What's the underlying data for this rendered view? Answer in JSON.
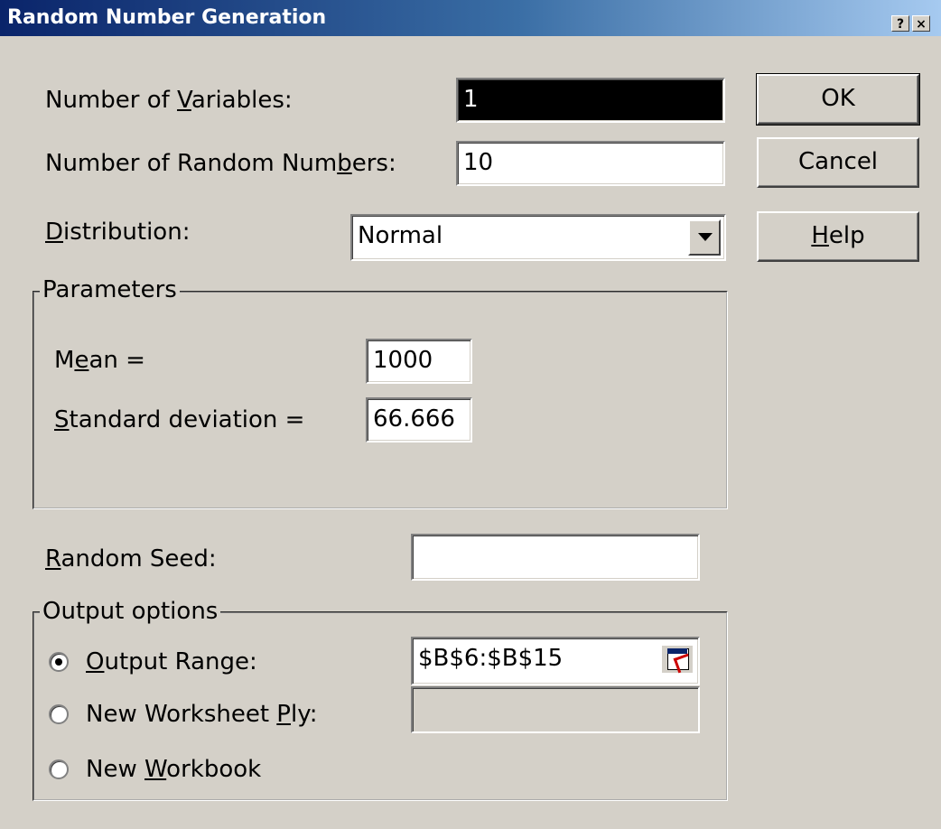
{
  "window": {
    "title": "Random Number Generation",
    "help_glyph": "?",
    "close_glyph": "×"
  },
  "fields": {
    "num_variables": {
      "label_pre": "Number of ",
      "label_mn": "V",
      "label_post": "ariables:",
      "value": "1"
    },
    "num_random": {
      "label_pre": "Number of Random Num",
      "label_mn": "b",
      "label_post": "ers:",
      "value": "10"
    },
    "distribution": {
      "label_pre": "",
      "label_mn": "D",
      "label_post": "istribution:",
      "value": "Normal"
    },
    "random_seed": {
      "label_pre": "",
      "label_mn": "R",
      "label_post": "andom Seed:",
      "value": ""
    }
  },
  "parameters": {
    "legend": "Parameters",
    "mean": {
      "label_pre": "M",
      "label_mn": "e",
      "label_post": "an =",
      "value": "1000"
    },
    "stddev": {
      "label_pre": "",
      "label_mn": "S",
      "label_post": "tandard deviation =",
      "value": "66.666"
    }
  },
  "output": {
    "legend": "Output options",
    "output_range": {
      "label_pre": "",
      "label_mn": "O",
      "label_post": "utput Range:",
      "value": "$B$6:$B$15",
      "checked": true
    },
    "new_ply": {
      "label_pre": "New Worksheet ",
      "label_mn": "P",
      "label_post": "ly:",
      "value": "",
      "checked": false
    },
    "new_workbook": {
      "label_pre": "New ",
      "label_mn": "W",
      "label_post": "orkbook",
      "checked": false
    }
  },
  "buttons": {
    "ok": "OK",
    "cancel": "Cancel",
    "help": {
      "mn": "H",
      "rest": "elp"
    }
  }
}
